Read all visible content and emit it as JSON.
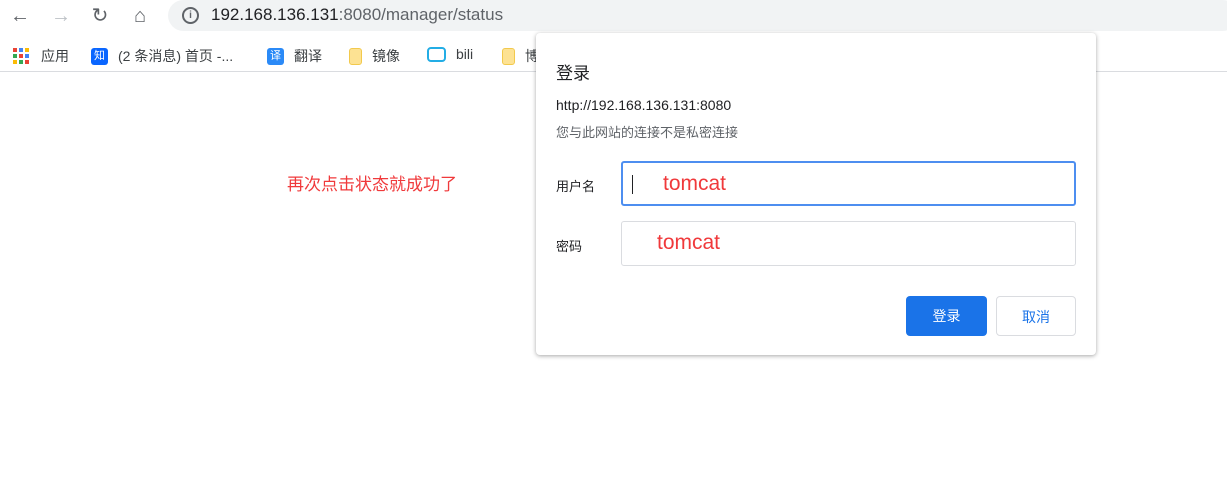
{
  "browser": {
    "url_host": "192.168.136.131",
    "url_rest": ":8080/manager/status",
    "bookmarks": [
      {
        "label": "应用",
        "icon": "apps-grid-icon"
      },
      {
        "label": "(2 条消息) 首页 -...",
        "icon": "zhihu-icon",
        "icon_text": "知"
      },
      {
        "label": "翻译",
        "icon": "translate-icon",
        "icon_text": "译"
      },
      {
        "label": "镜像",
        "icon": "folder-icon"
      },
      {
        "label": "bili",
        "icon": "bilibili-icon"
      },
      {
        "label": "博",
        "icon": "folder-icon"
      }
    ]
  },
  "annotation": "再次点击状态就成功了",
  "dialog": {
    "title": "登录",
    "origin": "http://192.168.136.131:8080",
    "warning": "您与此网站的连接不是私密连接",
    "username_label": "用户名",
    "username_value": "tomcat",
    "password_label": "密码",
    "password_value": "tomcat",
    "login_button": "登录",
    "cancel_button": "取消"
  },
  "colors": {
    "accent": "#1a73e8",
    "annotation": "#f0393b",
    "focus": "#4d8ef0"
  }
}
